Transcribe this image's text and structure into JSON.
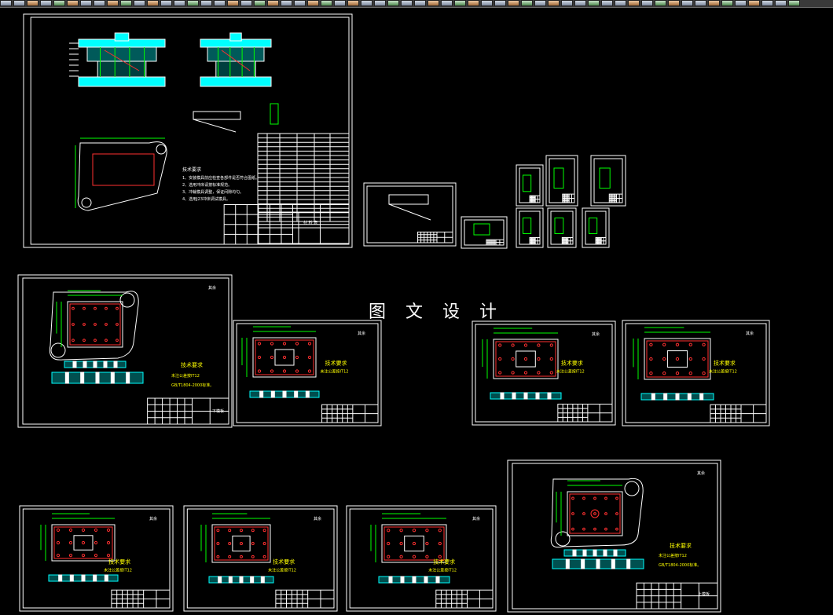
{
  "app": {
    "window": "CAD drawing viewer",
    "watermark": "图 文 设 计"
  },
  "toolbar": {
    "button_count": 60
  },
  "drawing": {
    "title_block_label_main": "材 料 表",
    "tech_requirements_title": "技术要求",
    "tech_requirements_lines": [
      "1、安装模具前应检查各部件是否符合图纸。",
      "2、选用冲床请按标准规范。",
      "3、冲裁模具调整，保证间隙均匀。",
      "4、选用J23冲床调试模具。"
    ],
    "small_note": "技术要求",
    "sheet_tag_lower_plate": "下模板",
    "sheet_tag_upper_plate": "上模板",
    "roughness_mark": "其余"
  },
  "colors": {
    "frame": "#ffffff",
    "cyan": "#00ffff",
    "green": "#00ff00",
    "red": "#ff3030",
    "yellow": "#ffff00",
    "magenta": "#ff00ff",
    "background": "#000000"
  }
}
